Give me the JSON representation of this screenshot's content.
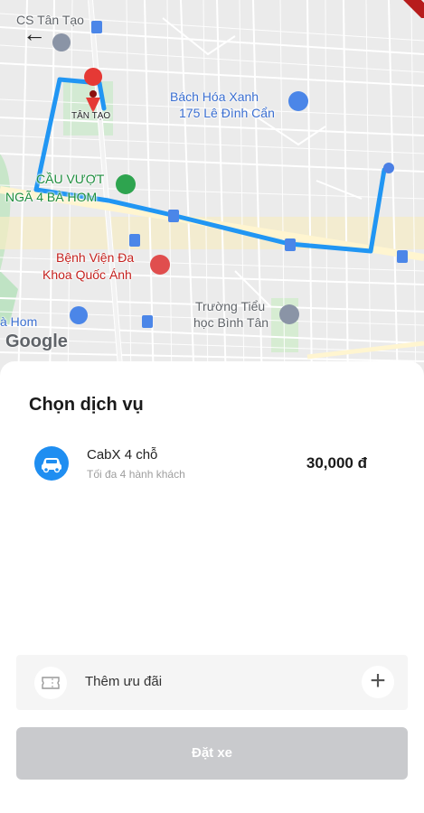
{
  "map": {
    "labels": {
      "top_left_partial": "CS Tân Tạo",
      "tan_tao": "TÂN TẠO",
      "bach_hoa_line1": "Bách Hóa Xanh",
      "bach_hoa_line2": "175 Lê Đình Cẩn",
      "cau_vuot_line1": "CẦU VƯỢT",
      "cau_vuot_line2": "NGÃ 4 BÀ HOM",
      "benh_vien_line1": "Bệnh Viện Đa",
      "benh_vien_line2": "Khoa Quốc Ánh",
      "truong_line1": "Trường Tiểu",
      "truong_line2": "học Bình Tân",
      "ba_hom_partial": "à Hom"
    },
    "attribution": "Google",
    "route_color": "#2196f3"
  },
  "icons": {
    "back": "back-arrow-icon",
    "car": "car-icon",
    "coupon": "coupon-icon",
    "add": "plus-icon"
  },
  "sheet": {
    "title": "Chọn dịch vụ",
    "service": {
      "name": "CabX 4 chỗ",
      "subtitle": "Tối đa 4 hành khách",
      "price": "30,000 đ"
    },
    "promo_label": "Thêm ưu đãi",
    "book_button": "Đặt xe"
  }
}
